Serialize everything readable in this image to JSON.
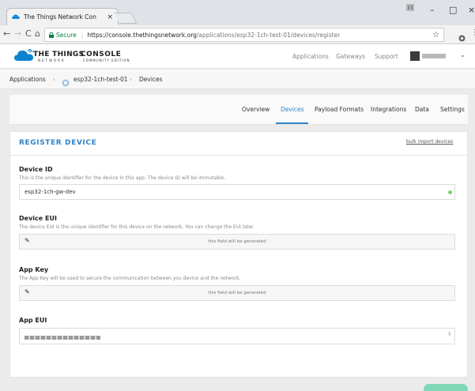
{
  "browser": {
    "tab_title": "The Things Network Con",
    "tab_close": "×",
    "secure": "Secure",
    "url_host": "https://console.thethingsnetwork.org",
    "url_path": "/applications/esp32-1ch-test-01/devices/register",
    "back": "←",
    "forward": "→",
    "reload": "C",
    "home": "⌂",
    "star": "☆",
    "minimize": "–",
    "maximize": "□",
    "close": "×"
  },
  "header": {
    "brand_top": "THE THINGS",
    "brand_bottom": "NETWORK",
    "console": "CONSOLE",
    "edition": "COMMUNITY EDITION",
    "nav": [
      "Applications",
      "Gateways",
      "Support"
    ],
    "chevron": "⌄"
  },
  "breadcrumb": {
    "items": [
      "Applications",
      "esp32-1ch-test-01",
      "Devices"
    ],
    "sep": "›"
  },
  "tabs": {
    "items": [
      "Overview",
      "Devices",
      "Payload Formats",
      "Integrations",
      "Data",
      "Settings"
    ],
    "active": "Devices"
  },
  "form": {
    "title": "REGISTER DEVICE",
    "bulk_import": "bulk import devices",
    "device_id": {
      "label": "Device ID",
      "desc": "This is the unique identifier for the device in this app. The device ID will be immutable.",
      "value": "esp32-1ch-gw-dev"
    },
    "device_eui": {
      "label": "Device EUI",
      "desc": "The device EUI is the unique identifier for this device on the network. You can change the EUI later.",
      "placeholder": "this field will be generated"
    },
    "app_key": {
      "label": "App Key",
      "desc": "The App Key will be used to secure the communication between you device and the network.",
      "placeholder": "this field will be generated"
    },
    "app_eui": {
      "label": "App EUI"
    },
    "pencil_glyph": "✎",
    "spinner_glyph": "⇕"
  },
  "colors": {
    "accent": "#3283c5",
    "ok": "#7cd36a",
    "fab": "#7fd9b8"
  }
}
